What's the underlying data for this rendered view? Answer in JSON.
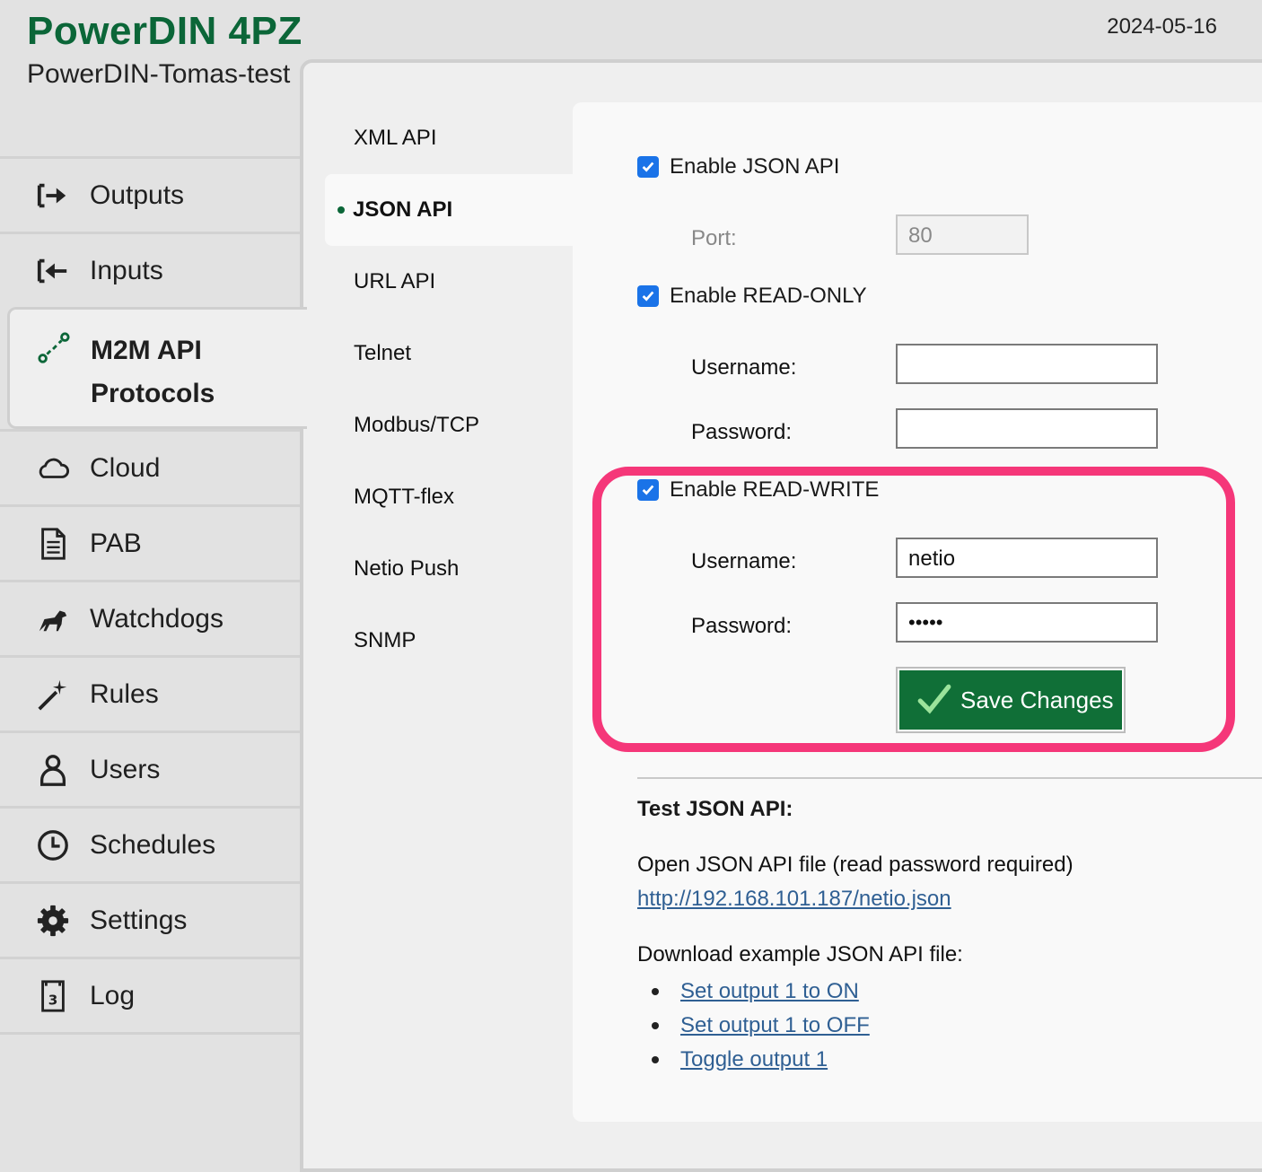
{
  "header": {
    "title": "PowerDIN 4PZ",
    "device_name": "PowerDIN-Tomas-test",
    "date": "2024-05-16"
  },
  "sidebar": {
    "items": [
      {
        "label": "Outputs",
        "icon": "outputs-icon"
      },
      {
        "label": "Inputs",
        "icon": "inputs-icon"
      },
      {
        "label": "M2M API",
        "label2": "Protocols",
        "icon": "m2m-api-icon",
        "active": true
      },
      {
        "label": "Cloud",
        "icon": "cloud-icon"
      },
      {
        "label": "PAB",
        "icon": "document-icon"
      },
      {
        "label": "Watchdogs",
        "icon": "dog-icon"
      },
      {
        "label": "Rules",
        "icon": "magic-wand-icon"
      },
      {
        "label": "Users",
        "icon": "user-icon"
      },
      {
        "label": "Schedules",
        "icon": "clock-icon"
      },
      {
        "label": "Settings",
        "icon": "gear-icon"
      },
      {
        "label": "Log",
        "icon": "log-icon"
      }
    ]
  },
  "subnav": {
    "items": [
      "XML API",
      "JSON API",
      "URL API",
      "Telnet",
      "Modbus/TCP",
      "MQTT-flex",
      "Netio Push",
      "SNMP"
    ],
    "active": "JSON API"
  },
  "form": {
    "enable_json": {
      "label": "Enable JSON API",
      "checked": true
    },
    "port": {
      "label": "Port:",
      "value": "80"
    },
    "enable_ro": {
      "label": "Enable READ-ONLY",
      "checked": true
    },
    "ro_username": {
      "label": "Username:",
      "value": ""
    },
    "ro_password": {
      "label": "Password:",
      "value": ""
    },
    "enable_rw": {
      "label": "Enable READ-WRITE",
      "checked": true
    },
    "rw_username": {
      "label": "Username:",
      "value": "netio"
    },
    "rw_password": {
      "label": "Password:",
      "value": "netio"
    },
    "save_label": "Save Changes"
  },
  "test": {
    "title": "Test JSON API:",
    "open_text": "Open JSON API file (read password required)",
    "open_link": "http://192.168.101.187/netio.json",
    "download_text": "Download example JSON API file:",
    "examples": [
      "Set output 1 to ON",
      "Set output 1 to OFF",
      "Toggle output 1"
    ]
  },
  "colors": {
    "brand_green": "#0b6638",
    "save_green": "#106f37",
    "checkbox_blue": "#1a73e8",
    "highlight_pink": "#f53779",
    "link_blue": "#2f5f93"
  }
}
